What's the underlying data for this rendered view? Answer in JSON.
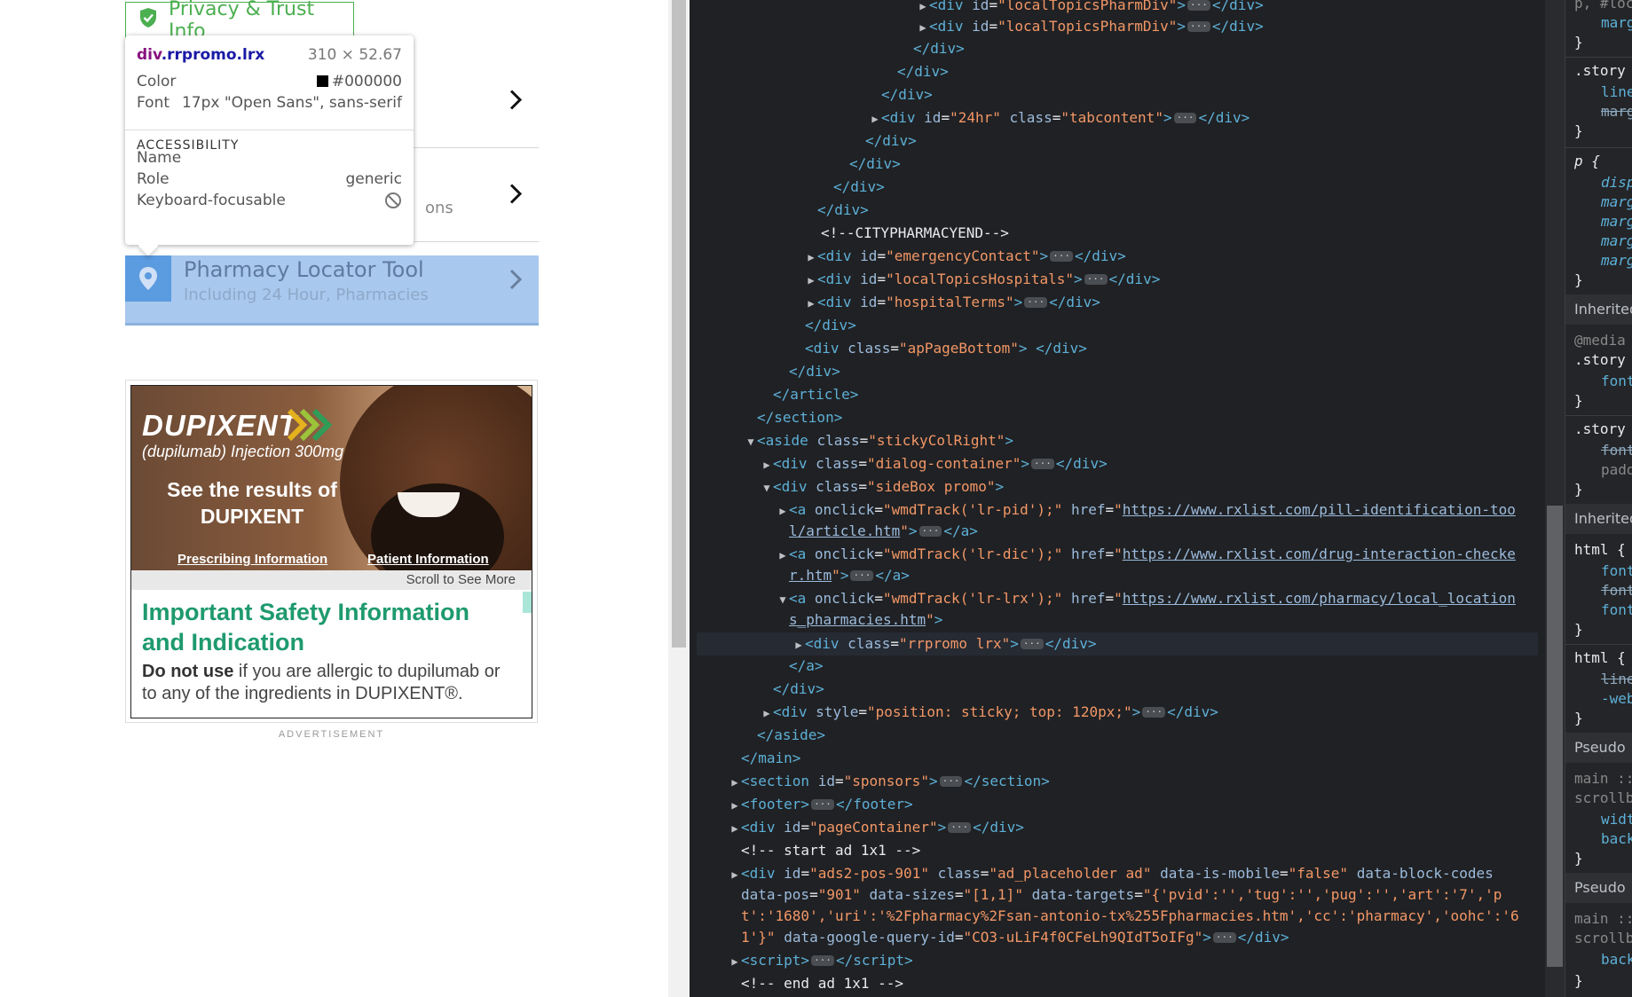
{
  "page": {
    "privacy_label": "Privacy & Trust Info",
    "row2_sub": "ons",
    "lrx_title": "Pharmacy Locator Tool",
    "lrx_sub": "Including 24 Hour, Pharmacies"
  },
  "tooltip": {
    "tag": "div",
    "classes": ".rrpromo.lrx",
    "size": "310 × 52.67",
    "color_label": "Color",
    "color_value": "#000000",
    "font_label": "Font",
    "font_value": "17px \"Open Sans\", sans-serif",
    "a11y_heading": "ACCESSIBILITY",
    "name_label": "Name",
    "role_label": "Role",
    "role_value": "generic",
    "focus_label": "Keyboard-focusable"
  },
  "ad": {
    "brand": "DUPIXENT",
    "generic": "(dupilumab) Injection 300mg",
    "see_results": "See the results of DUPIXENT",
    "prescribing": "Prescribing Information",
    "patient": "Patient Information",
    "scroll": "Scroll to See More",
    "isi_title": "Important Safety Information and Indication",
    "isi_bold": "Do not use",
    "isi_rest": " if you are allergic to dupilumab or to any of the ingredients in DUPIXENT®.",
    "label": "ADVERTISEMENT"
  },
  "dom": {
    "l1": "localTopicsPharmDiv",
    "l2": "localTopicsPharmDiv",
    "l6_id": "24hr",
    "l6_class": "tabcontent",
    "comment1": "<!--CITYPHARMACYEND-->",
    "id_emergency": "emergencyContact",
    "id_hospitals": "localTopicsHospitals",
    "id_terms": "hospitalTerms",
    "class_bottom": "apPageBottom",
    "class_aside": "stickyColRight",
    "class_dialog": "dialog-container",
    "class_sidebox": "sideBox promo",
    "onclick_pid": "wmdTrack('lr-pid');",
    "href_pid_1": "https://www.rxlist.com/pill-identification-too",
    "href_pid_2": "l/article.htm",
    "onclick_dic": "wmdTrack('lr-dic');",
    "href_dic_1": "https://www.rxlist.com/drug-interaction-checke",
    "href_dic_2": "r.htm",
    "onclick_lrx": "wmdTrack('lr-lrx');",
    "href_lrx_1": "https://www.rxlist.com/pharmacy/local_location",
    "href_lrx_2": "s_pharmacies.htm",
    "class_rrpromo": "rrpromo lrx",
    "style_sticky": "position: sticky; top: 120px;",
    "id_sponsors": "sponsors",
    "id_pagecontainer": "pageContainer",
    "comment_start": "<!-- start ad 1x1 -->",
    "ads_id": "ads2-pos-901",
    "ads_class": "ad_placeholder ad",
    "ads_mobile": "false",
    "ads_pos": "901",
    "ads_sizes": "[1,1]",
    "ads_targets_1": "{'pvid':'','tug':'','pug':'','art':'7','p",
    "ads_targets_2": "t':'1680','uri':'%2Fpharmacy%2Fsan-antonio-tx%255Fpharmacies.htm','cc':'pharmacy','oohc':'6",
    "ads_targets_3": "1'}",
    "ads_gq": "CO3-uLiF4f0CFeLh9QIdT5oIFg",
    "comment_end": "<!-- end ad 1x1 -->"
  },
  "styles": {
    "items": [
      "p, #loc",
      "marg",
      "}",
      ".story",
      "line",
      "marg",
      "}",
      "p {",
      "disp",
      "marg",
      "marg",
      "marg",
      "marg",
      "}",
      "Inherited",
      "@media",
      ".story",
      "font",
      "}",
      ".story",
      "font",
      "padd",
      "}",
      "Inherited",
      "html {",
      "font",
      "font",
      "font",
      "}",
      "html {",
      "line",
      "-web",
      "}",
      "Pseudo",
      "main ::",
      "scrollb",
      "widt",
      "back",
      "}",
      "Pseudo",
      "main ::",
      "scrollb",
      "back",
      "}"
    ]
  },
  "colors": {
    "devtools_bg": "#202124",
    "tag": "#5db0d7",
    "attr": "#9bbbdc",
    "value": "#f29766",
    "privacy_green": "#4caf50",
    "isi_green": "#1e9a6e",
    "highlight_blue": "#a8c8ee"
  }
}
